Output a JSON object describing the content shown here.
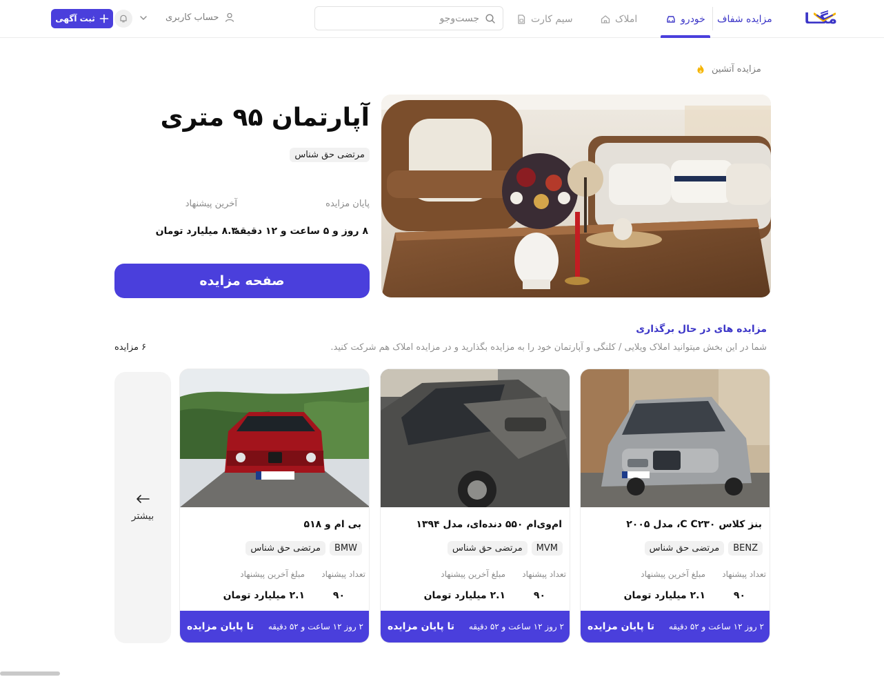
{
  "header": {
    "logo_text": "مگــا",
    "nav": {
      "transparent_label": "مزایده شفاف",
      "car_label": "خودرو",
      "property_label": "املاک",
      "simcard_label": "سیم کارت"
    },
    "search": {
      "placeholder": "جست‌وجو"
    },
    "account_label": "حساب کاربری",
    "post_ad_label": "ثبت آگهی"
  },
  "breadcrumb": {
    "label": "مزایده آتشین"
  },
  "hero": {
    "title": "آپارتمان ۹۵ متری",
    "owner": "مرتضی حق شناس",
    "end_label": "پایان مزایده",
    "end_value": "۸ روز و ۵ ساعت و ۱۲ دقیقه",
    "last_offer_label": "آخرین پیشنهاد",
    "last_offer_value": "۸.۳ میلیارد تومان",
    "button_label": "صفحه مزایده"
  },
  "section": {
    "title": "مزایده های در حال برگذاری",
    "description": "شما در این بخش میتوانید املاک  ویلایی / کلنگی و آپارتمان خود را به مزایده بگذارید و در مزایده املاک هم شرکت کنید.",
    "count": "۶ مزایده",
    "more_label": "بیشتر"
  },
  "cards": [
    {
      "title": "بنز کلاس C C۲۳۰، مدل ۲۰۰۵",
      "brand": "BENZ",
      "owner": "مرتضی حق شناس",
      "offers_label": "تعداد پیشنهاد",
      "offers_value": "۹۰",
      "last_offer_label": "مبلغ آخرین پیشنهاد",
      "last_offer_value": "۲.۱ میلیارد تومان",
      "time_left": "۲ روز ۱۲ ساعت و ۵۲ دقیقه",
      "time_label": "تا پایان مزایده"
    },
    {
      "title": "ام‌وی‌ام ۵۵۰ دنده‌ای، مدل ۱۳۹۴",
      "brand": "MVM",
      "owner": "مرتضی حق شناس",
      "offers_label": "تعداد پیشنهاد",
      "offers_value": "۹۰",
      "last_offer_label": "مبلغ آخرین پیشنهاد",
      "last_offer_value": "۲.۱ میلیارد تومان",
      "time_left": "۲ روز ۱۲ ساعت و ۵۲ دقیقه",
      "time_label": "تا پایان مزایده"
    },
    {
      "title": "بی ام و ۵۱۸",
      "brand": "BMW",
      "owner": "مرتضی حق شناس",
      "offers_label": "تعداد پیشنهاد",
      "offers_value": "۹۰",
      "last_offer_label": "مبلغ آخرین پیشنهاد",
      "last_offer_value": "۲.۱ میلیارد تومان",
      "time_left": "۲ روز ۱۲ ساعت و ۵۲ دقیقه",
      "time_label": "تا پایان مزایده"
    }
  ],
  "colors": {
    "brand": "#4a3fdc",
    "brand_text": "#3b35c7",
    "accent_fire": "#f5b400"
  }
}
